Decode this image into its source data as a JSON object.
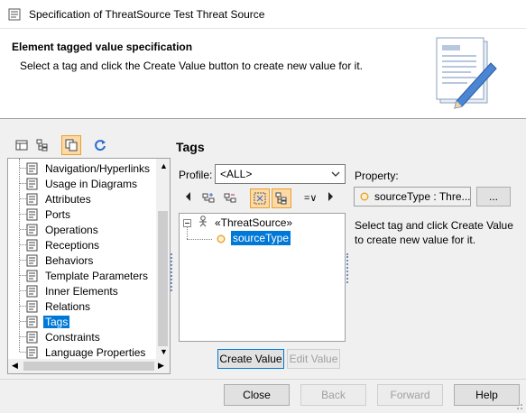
{
  "window": {
    "title": "Specification of ThreatSource Test Threat Source"
  },
  "header": {
    "title": "Element tagged value specification",
    "description": "Select a tag and click the Create Value button to create new value for it."
  },
  "left_toolbar": {
    "icons": [
      "table-icon",
      "tree-icon",
      "copy-icon",
      "refresh-icon"
    ]
  },
  "nav_tree": {
    "items": [
      {
        "label": "Navigation/Hyperlinks"
      },
      {
        "label": "Usage in Diagrams"
      },
      {
        "label": "Attributes"
      },
      {
        "label": "Ports"
      },
      {
        "label": "Operations"
      },
      {
        "label": "Receptions"
      },
      {
        "label": "Behaviors"
      },
      {
        "label": "Template Parameters"
      },
      {
        "label": "Inner Elements"
      },
      {
        "label": "Relations"
      },
      {
        "label": "Tags",
        "selected": true
      },
      {
        "label": "Constraints"
      },
      {
        "label": "Language Properties"
      }
    ]
  },
  "tags_panel": {
    "title": "Tags",
    "profile_label": "Profile:",
    "profile_value": "<ALL>",
    "toolbar_extra": "=∨",
    "tree": {
      "root": "«ThreatSource»",
      "child": "sourceType"
    },
    "create_value": "Create Value",
    "edit_value": "Edit Value"
  },
  "property_panel": {
    "label": "Property:",
    "value": "sourceType : Thre...",
    "browse": "...",
    "help": "Select tag and click Create Value to create new value for it."
  },
  "footer": {
    "close": "Close",
    "back": "Back",
    "forward": "Forward",
    "help": "Help"
  },
  "colors": {
    "accent": "#0078d7",
    "active_tool": "#fdd9a6",
    "tag_icon": "#e8a030"
  }
}
